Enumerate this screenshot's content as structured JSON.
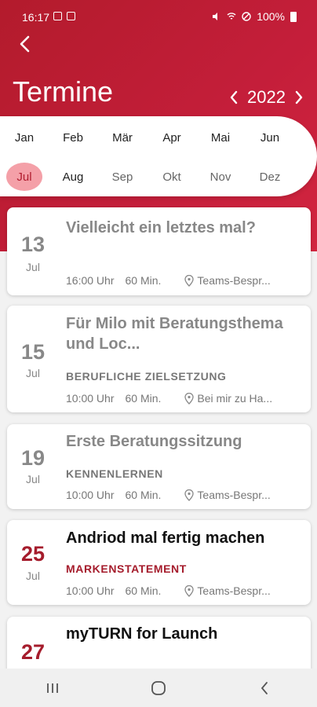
{
  "status": {
    "time": "16:17",
    "battery": "100%"
  },
  "header": {
    "title": "Termine",
    "year": "2022"
  },
  "months": {
    "row1": [
      "Jan",
      "Feb",
      "Mär",
      "Apr",
      "Mai",
      "Jun"
    ],
    "row2": [
      "Jul",
      "Aug",
      "Sep",
      "Okt",
      "Nov",
      "Dez"
    ],
    "selected": "Jul"
  },
  "appointments": [
    {
      "day": "13",
      "month": "Jul",
      "title": "Vielleicht ein letztes mal?",
      "category": "",
      "time": "16:00 Uhr",
      "duration": "60 Min.",
      "location": "Teams-Bespr..."
    },
    {
      "day": "15",
      "month": "Jul",
      "title": "Für Milo mit Beratungsthema und Loc...",
      "category": "BERUFLICHE ZIELSETZUNG",
      "time": "10:00 Uhr",
      "duration": "60 Min.",
      "location": "Bei mir zu Ha..."
    },
    {
      "day": "19",
      "month": "Jul",
      "title": "Erste Beratungssitzung",
      "category": "KENNENLERNEN",
      "time": "10:00 Uhr",
      "duration": "60 Min.",
      "location": "Teams-Bespr..."
    },
    {
      "day": "25",
      "month": "Jul",
      "title": "Andriod mal fertig machen",
      "category": "MARKENSTATEMENT",
      "time": "10:00 Uhr",
      "duration": "60 Min.",
      "location": "Teams-Bespr..."
    },
    {
      "day": "27",
      "month": "",
      "title": "myTURN for Launch",
      "category": "",
      "time": "",
      "duration": "",
      "location": ""
    }
  ],
  "colors": {
    "brand": "#c41e3a",
    "selected_month_bg": "#f4a0a8",
    "active_date": "#a51c2c"
  }
}
